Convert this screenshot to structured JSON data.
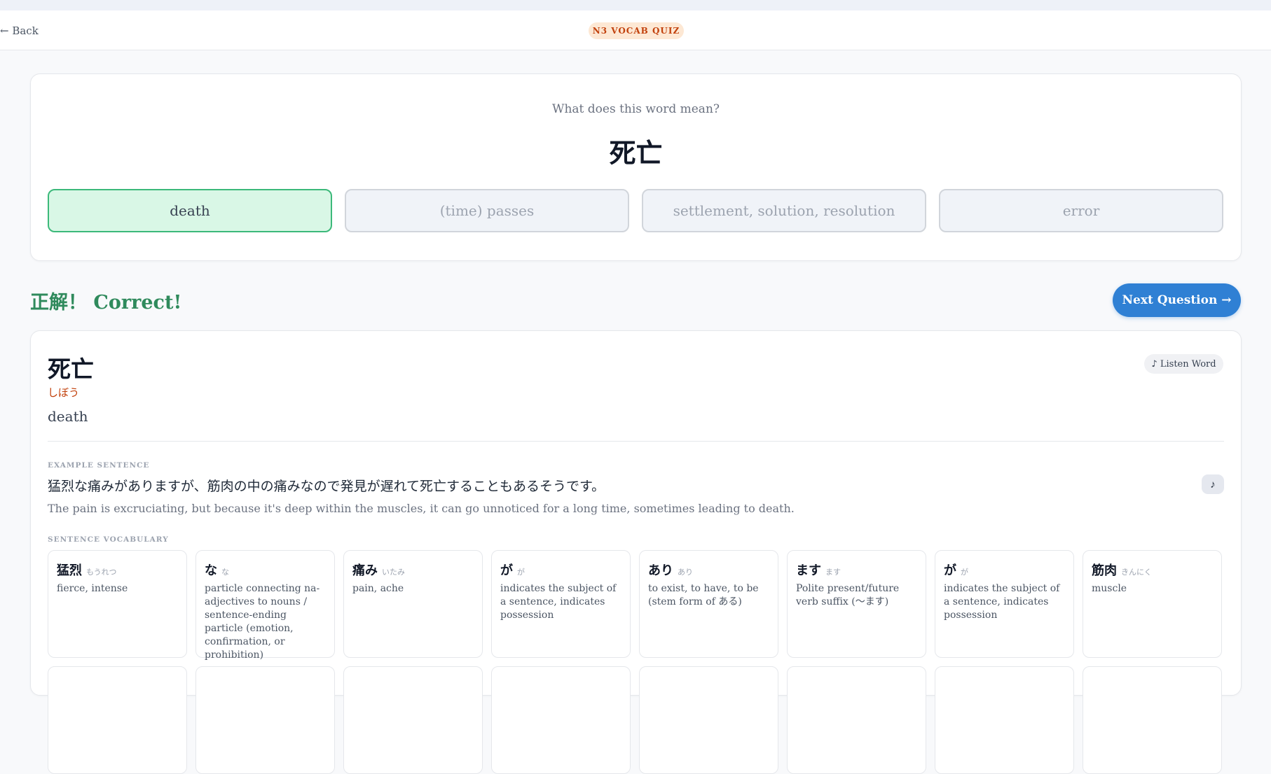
{
  "header": {
    "back_label": "← Back",
    "badge": "N3 VOCAB QUIZ"
  },
  "question": {
    "prompt": "What does this word mean?",
    "word": "死亡",
    "options": [
      {
        "label": "death",
        "state": "correct"
      },
      {
        "label": "(time) passes",
        "state": "disabled"
      },
      {
        "label": "settlement, solution, resolution",
        "state": "disabled"
      },
      {
        "label": "error",
        "state": "disabled"
      }
    ]
  },
  "result": {
    "label": "正解！ Correct!",
    "next_label": "Next Question →"
  },
  "detail": {
    "word": "死亡",
    "reading": "しぼう",
    "meaning": "death",
    "listen_label": "♪ Listen Word",
    "example_label": "EXAMPLE SENTENCE",
    "example_ja": "猛烈な痛みがありますが、筋肉の中の痛みなので発見が遅れて死亡することもあるそうです。",
    "example_en": "The pain is excruciating, but because it's deep within the muscles, it can go unnoticed for a long time, sometimes leading to death.",
    "play_icon": "♪",
    "vocab_label": "SENTENCE VOCABULARY",
    "vocab": [
      {
        "word": "猛烈",
        "reading": "もうれつ",
        "meaning": "fierce, intense"
      },
      {
        "word": "な",
        "reading": "な",
        "meaning": "particle connecting na-adjectives to nouns / sentence-ending particle (emotion, confirmation, or prohibition)"
      },
      {
        "word": "痛み",
        "reading": "いたみ",
        "meaning": "pain, ache"
      },
      {
        "word": "が",
        "reading": "が",
        "meaning": "indicates the subject of a sentence, indicates possession"
      },
      {
        "word": "あり",
        "reading": "あり",
        "meaning": "to exist, to have, to be (stem form of ある)"
      },
      {
        "word": "ます",
        "reading": "ます",
        "meaning": "Polite present/future verb suffix (〜ます)"
      },
      {
        "word": "が",
        "reading": "が",
        "meaning": "indicates the subject of a sentence, indicates possession"
      },
      {
        "word": "筋肉",
        "reading": "きんにく",
        "meaning": "muscle"
      }
    ]
  },
  "colors": {
    "accent": "#2f80d4",
    "correct_bg": "#d9f7e6",
    "correct_border": "#3cb97a",
    "success_text": "#2f8a5c",
    "reading": "#c2410c"
  }
}
